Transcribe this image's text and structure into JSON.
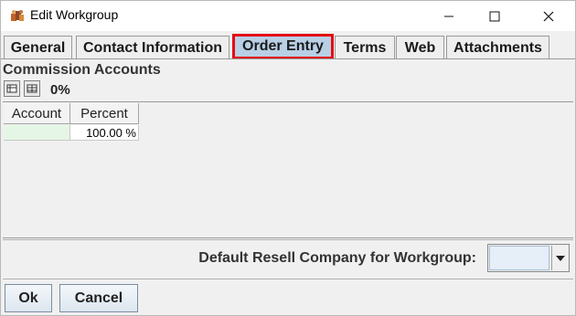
{
  "window": {
    "title": "Edit Workgroup",
    "icon": "workgroup-app-icon",
    "controls": [
      "minimize-icon",
      "maximize-icon",
      "close-icon"
    ]
  },
  "tabs": [
    {
      "label": "General",
      "active": false
    },
    {
      "label": "Contact Information",
      "active": false
    },
    {
      "label": "Order Entry",
      "active": true
    },
    {
      "label": "Terms",
      "active": false
    },
    {
      "label": "Web",
      "active": false
    },
    {
      "label": "Attachments",
      "active": false
    }
  ],
  "commission": {
    "section_title": "Commission Accounts",
    "total_percent": "0%",
    "toolbar": [
      "add-row-icon",
      "delete-row-icon"
    ],
    "columns": [
      "Account",
      "Percent"
    ],
    "rows": [
      {
        "account": "",
        "percent": "100.00 %"
      }
    ]
  },
  "resell": {
    "label": "Default Resell Company for Workgroup:",
    "selected_value": ""
  },
  "buttons": {
    "ok": "Ok",
    "cancel": "Cancel"
  },
  "colors": {
    "active_tab_bg": "#b8cfe5",
    "highlight_border": "#e30b13",
    "account_cell_bg": "#e6f6e6"
  }
}
